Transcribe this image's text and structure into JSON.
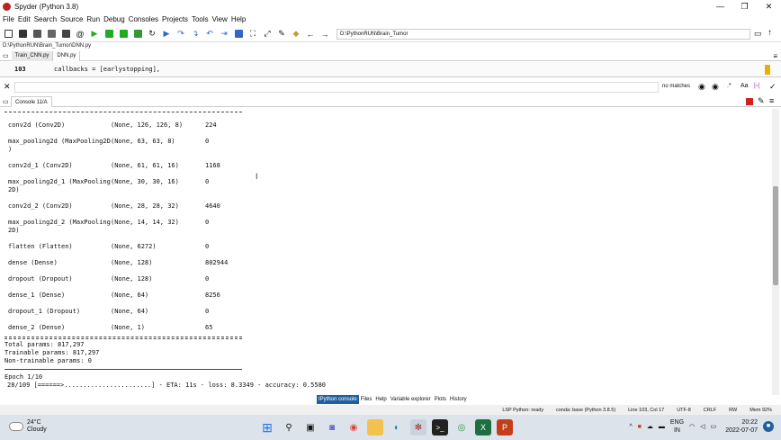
{
  "window": {
    "title": "Spyder (Python 3.8)",
    "min": "—",
    "max": "❐",
    "close": "✕"
  },
  "menu": [
    "File",
    "Edit",
    "Search",
    "Source",
    "Run",
    "Debug",
    "Consoles",
    "Projects",
    "Tools",
    "View",
    "Help"
  ],
  "toolbar": {
    "path": "D:\\PythonRUN\\Brain_Tumor"
  },
  "filepath": "D:\\PythonRUN\\Brain_Tumor\\DNN.py",
  "editor_tabs": [
    {
      "label": "Train_CNN.py"
    },
    {
      "label": "DNN.py"
    }
  ],
  "editor": {
    "line_number": "103",
    "code": "callbacks = [earlystopping],"
  },
  "find": {
    "status": "no matches"
  },
  "console_tab": "Console 11/A",
  "summary_rows": [
    {
      "layer": "conv2d (Conv2D)",
      "shape": "(None, 126, 126, 8)",
      "params": "224"
    },
    {
      "layer": "max_pooling2d (MaxPooling2D",
      "layer2": ")",
      "shape": "(None, 63, 63, 8)",
      "params": "0"
    },
    {
      "layer": "conv2d_1 (Conv2D)",
      "shape": "(None, 61, 61, 16)",
      "params": "1168"
    },
    {
      "layer": "max_pooling2d_1 (MaxPooling",
      "layer2": "2D)",
      "shape": "(None, 30, 30, 16)",
      "params": "0"
    },
    {
      "layer": "conv2d_2 (Conv2D)",
      "shape": "(None, 28, 28, 32)",
      "params": "4640"
    },
    {
      "layer": "max_pooling2d_2 (MaxPooling",
      "layer2": "2D)",
      "shape": "(None, 14, 14, 32)",
      "params": "0"
    },
    {
      "layer": "flatten (Flatten)",
      "shape": "(None, 6272)",
      "params": "0"
    },
    {
      "layer": "dense (Dense)",
      "shape": "(None, 128)",
      "params": "802944"
    },
    {
      "layer": "dropout (Dropout)",
      "shape": "(None, 128)",
      "params": "0"
    },
    {
      "layer": "dense_1 (Dense)",
      "shape": "(None, 64)",
      "params": "8256"
    },
    {
      "layer": "dropout_1 (Dropout)",
      "shape": "(None, 64)",
      "params": "0"
    },
    {
      "layer": "dense_2 (Dense)",
      "shape": "(None, 1)",
      "params": "65"
    }
  ],
  "totals": {
    "total": "Total params: 817,297",
    "trainable": "Trainable params: 817,297",
    "non_trainable": "Non-trainable params: 0"
  },
  "epoch": {
    "label": "Epoch 1/10",
    "progress": "28/109 [======>.......................] - ETA: 11s - loss: 8.3349 - accuracy: 0.5580"
  },
  "bottom_tabs": [
    "IPython console",
    "Files",
    "Help",
    "Variable explorer",
    "Plots",
    "History"
  ],
  "status": [
    "LSP Python: ready",
    "conda: base (Python 3.8.5)",
    "Line 103, Col 17",
    "UTF-8",
    "CRLF",
    "RW",
    "Mem 92%"
  ],
  "taskbar": {
    "temp": "24°C",
    "condition": "Cloudy",
    "lang1": "ENG",
    "lang2": "IN",
    "time": "20:22",
    "date": "2022-07-07"
  },
  "colors": {
    "accent": "#2060a0",
    "taskbar": "#dde3ea"
  }
}
